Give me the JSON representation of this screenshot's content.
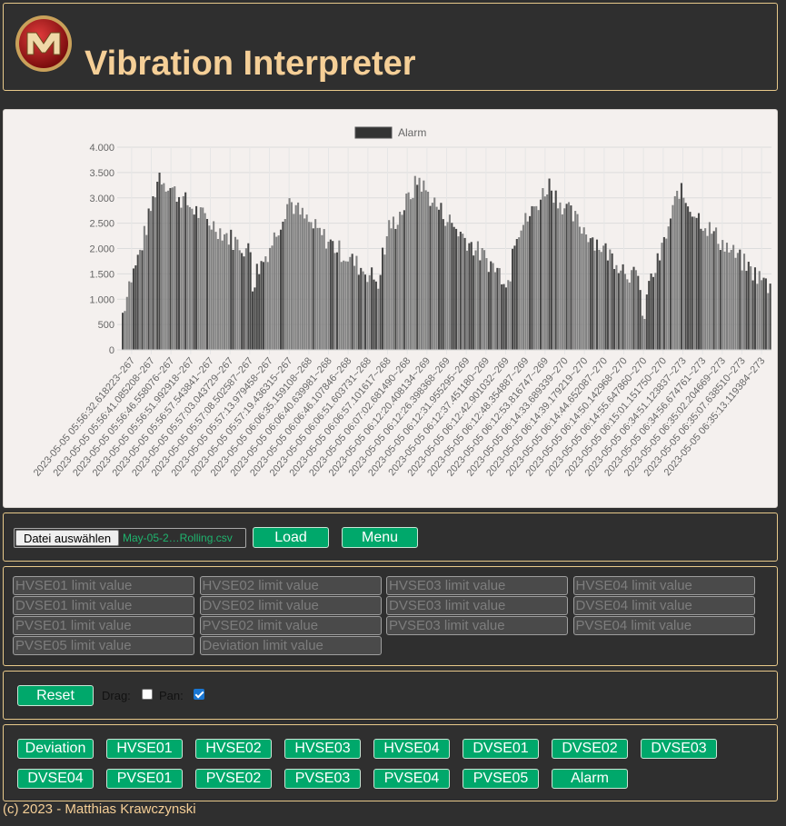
{
  "header": {
    "title": "Vibration Interpreter",
    "logo_icon": "mk-logo-icon"
  },
  "chart_data": {
    "type": "bar",
    "title": "",
    "legend": {
      "label": "Alarm",
      "placement": "top-center"
    },
    "ylim": [
      0,
      4000
    ],
    "y_ticks": [
      "0",
      "500",
      "1.000",
      "1.500",
      "2.000",
      "2.500",
      "3.000",
      "3.500",
      "4.000"
    ],
    "grid": true,
    "x_tick_labels": [
      "2023-05-05 05:56:32.618223~267",
      "2023-05-05 05:56:41.085208~267",
      "2023-05-05 05:56:46.558076~267",
      "2023-05-05 05:56:51.992918~267",
      "2023-05-05 05:56:57.543841~267",
      "2023-05-05 05:57:03.043729~267",
      "2023-05-05 05:57:08.502587~267",
      "2023-05-05 05:57:13.979458~267",
      "2023-05-05 05:57:19.436315~267",
      "2023-05-05 06:06:35.159108~268",
      "2023-05-05 06:06:40.639981~268",
      "2023-05-05 06:06:46.107846~268",
      "2023-05-05 06:06:51.603731~268",
      "2023-05-05 06:06:57.101617~268",
      "2023-05-05 06:07:02.681490~268",
      "2023-05-05 06:12:20.408134~269",
      "2023-05-05 06:12:26.398368~269",
      "2023-05-05 06:12:31.955295~269",
      "2023-05-05 06:12:37.451180~269",
      "2023-05-05 06:12:42.901032~269",
      "2023-05-05 06:12:48.354887~269",
      "2023-05-05 06:12:53.816747~269",
      "2023-05-05 06:14:33.689339~270",
      "2023-05-05 06:14:39.179219~270",
      "2023-05-05 06:14:44.652087~270",
      "2023-05-05 06:14:50.142968~270",
      "2023-05-05 06:14:55.647860~270",
      "2023-05-05 06:15:01.151750~270",
      "2023-05-05 06:34:51.123837~273",
      "2023-05-05 06:34:56.674761~273",
      "2023-05-05 06:35:02.204669~273",
      "2023-05-05 06:35:07.638510~273",
      "2023-05-05 06:35:13.119384~273"
    ],
    "profile_cycles": [
      {
        "label": "267",
        "start": 1100,
        "peak": 3500,
        "end": 1900
      },
      {
        "label": "268",
        "start": 1500,
        "peak": 3000,
        "end": 1300
      },
      {
        "label": "269",
        "start": 2300,
        "peak": 3400,
        "end": 1300
      },
      {
        "label": "270",
        "start": 2300,
        "peak": 3300,
        "end": 1300
      },
      {
        "label": "273",
        "start": 1100,
        "peak": 3200,
        "end": 1200
      }
    ],
    "colors": {
      "bar": "#7a7a7a",
      "bar_dark": "#3d3d3d",
      "legend_box": "#333333"
    }
  },
  "file": {
    "button_label": "Datei auswählen",
    "file_name": "May-05-2…Rolling.csv"
  },
  "buttons": {
    "load": "Load",
    "menu": "Menu",
    "reset": "Reset"
  },
  "limits": [
    "HVSE01 limit value",
    "HVSE02 limit value",
    "HVSE03 limit value",
    "HVSE04 limit value",
    "DVSE01 limit value",
    "DVSE02 limit value",
    "DVSE03 limit value",
    "DVSE04 limit value",
    "PVSE01 limit value",
    "PVSE02 limit value",
    "PVSE03 limit value",
    "PVSE04 limit value",
    "PVSE05 limit value",
    "Deviation limit value"
  ],
  "controls": {
    "drag_label": "Drag:",
    "drag_checked": false,
    "pan_label": "Pan:",
    "pan_checked": true
  },
  "series_buttons": [
    "Deviation",
    "HVSE01",
    "HVSE02",
    "HVSE03",
    "HVSE04",
    "DVSE01",
    "DVSE02",
    "DVSE03",
    "DVSE04",
    "PVSE01",
    "PVSE02",
    "PVSE03",
    "PVSE04",
    "PVSE05",
    "Alarm"
  ],
  "footer": {
    "text": "(c) 2023 - Matthias Krawczynski"
  },
  "colors": {
    "accent": "#00a86b",
    "title": "#f5cf97",
    "border": "#e8c98a",
    "background": "#2f2f2f"
  }
}
